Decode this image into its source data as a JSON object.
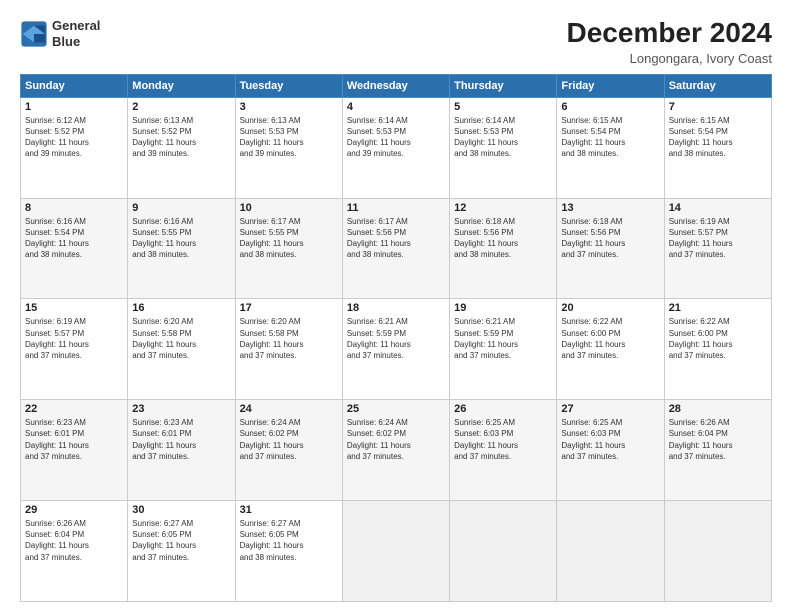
{
  "header": {
    "logo_line1": "General",
    "logo_line2": "Blue",
    "month": "December 2024",
    "location": "Longongara, Ivory Coast"
  },
  "weekdays": [
    "Sunday",
    "Monday",
    "Tuesday",
    "Wednesday",
    "Thursday",
    "Friday",
    "Saturday"
  ],
  "weeks": [
    [
      {
        "day": "1",
        "info": "Sunrise: 6:12 AM\nSunset: 5:52 PM\nDaylight: 11 hours\nand 39 minutes."
      },
      {
        "day": "2",
        "info": "Sunrise: 6:13 AM\nSunset: 5:52 PM\nDaylight: 11 hours\nand 39 minutes."
      },
      {
        "day": "3",
        "info": "Sunrise: 6:13 AM\nSunset: 5:53 PM\nDaylight: 11 hours\nand 39 minutes."
      },
      {
        "day": "4",
        "info": "Sunrise: 6:14 AM\nSunset: 5:53 PM\nDaylight: 11 hours\nand 39 minutes."
      },
      {
        "day": "5",
        "info": "Sunrise: 6:14 AM\nSunset: 5:53 PM\nDaylight: 11 hours\nand 38 minutes."
      },
      {
        "day": "6",
        "info": "Sunrise: 6:15 AM\nSunset: 5:54 PM\nDaylight: 11 hours\nand 38 minutes."
      },
      {
        "day": "7",
        "info": "Sunrise: 6:15 AM\nSunset: 5:54 PM\nDaylight: 11 hours\nand 38 minutes."
      }
    ],
    [
      {
        "day": "8",
        "info": "Sunrise: 6:16 AM\nSunset: 5:54 PM\nDaylight: 11 hours\nand 38 minutes."
      },
      {
        "day": "9",
        "info": "Sunrise: 6:16 AM\nSunset: 5:55 PM\nDaylight: 11 hours\nand 38 minutes."
      },
      {
        "day": "10",
        "info": "Sunrise: 6:17 AM\nSunset: 5:55 PM\nDaylight: 11 hours\nand 38 minutes."
      },
      {
        "day": "11",
        "info": "Sunrise: 6:17 AM\nSunset: 5:56 PM\nDaylight: 11 hours\nand 38 minutes."
      },
      {
        "day": "12",
        "info": "Sunrise: 6:18 AM\nSunset: 5:56 PM\nDaylight: 11 hours\nand 38 minutes."
      },
      {
        "day": "13",
        "info": "Sunrise: 6:18 AM\nSunset: 5:56 PM\nDaylight: 11 hours\nand 37 minutes."
      },
      {
        "day": "14",
        "info": "Sunrise: 6:19 AM\nSunset: 5:57 PM\nDaylight: 11 hours\nand 37 minutes."
      }
    ],
    [
      {
        "day": "15",
        "info": "Sunrise: 6:19 AM\nSunset: 5:57 PM\nDaylight: 11 hours\nand 37 minutes."
      },
      {
        "day": "16",
        "info": "Sunrise: 6:20 AM\nSunset: 5:58 PM\nDaylight: 11 hours\nand 37 minutes."
      },
      {
        "day": "17",
        "info": "Sunrise: 6:20 AM\nSunset: 5:58 PM\nDaylight: 11 hours\nand 37 minutes."
      },
      {
        "day": "18",
        "info": "Sunrise: 6:21 AM\nSunset: 5:59 PM\nDaylight: 11 hours\nand 37 minutes."
      },
      {
        "day": "19",
        "info": "Sunrise: 6:21 AM\nSunset: 5:59 PM\nDaylight: 11 hours\nand 37 minutes."
      },
      {
        "day": "20",
        "info": "Sunrise: 6:22 AM\nSunset: 6:00 PM\nDaylight: 11 hours\nand 37 minutes."
      },
      {
        "day": "21",
        "info": "Sunrise: 6:22 AM\nSunset: 6:00 PM\nDaylight: 11 hours\nand 37 minutes."
      }
    ],
    [
      {
        "day": "22",
        "info": "Sunrise: 6:23 AM\nSunset: 6:01 PM\nDaylight: 11 hours\nand 37 minutes."
      },
      {
        "day": "23",
        "info": "Sunrise: 6:23 AM\nSunset: 6:01 PM\nDaylight: 11 hours\nand 37 minutes."
      },
      {
        "day": "24",
        "info": "Sunrise: 6:24 AM\nSunset: 6:02 PM\nDaylight: 11 hours\nand 37 minutes."
      },
      {
        "day": "25",
        "info": "Sunrise: 6:24 AM\nSunset: 6:02 PM\nDaylight: 11 hours\nand 37 minutes."
      },
      {
        "day": "26",
        "info": "Sunrise: 6:25 AM\nSunset: 6:03 PM\nDaylight: 11 hours\nand 37 minutes."
      },
      {
        "day": "27",
        "info": "Sunrise: 6:25 AM\nSunset: 6:03 PM\nDaylight: 11 hours\nand 37 minutes."
      },
      {
        "day": "28",
        "info": "Sunrise: 6:26 AM\nSunset: 6:04 PM\nDaylight: 11 hours\nand 37 minutes."
      }
    ],
    [
      {
        "day": "29",
        "info": "Sunrise: 6:26 AM\nSunset: 6:04 PM\nDaylight: 11 hours\nand 37 minutes."
      },
      {
        "day": "30",
        "info": "Sunrise: 6:27 AM\nSunset: 6:05 PM\nDaylight: 11 hours\nand 37 minutes."
      },
      {
        "day": "31",
        "info": "Sunrise: 6:27 AM\nSunset: 6:05 PM\nDaylight: 11 hours\nand 38 minutes."
      },
      {
        "day": "",
        "info": ""
      },
      {
        "day": "",
        "info": ""
      },
      {
        "day": "",
        "info": ""
      },
      {
        "day": "",
        "info": ""
      }
    ]
  ]
}
